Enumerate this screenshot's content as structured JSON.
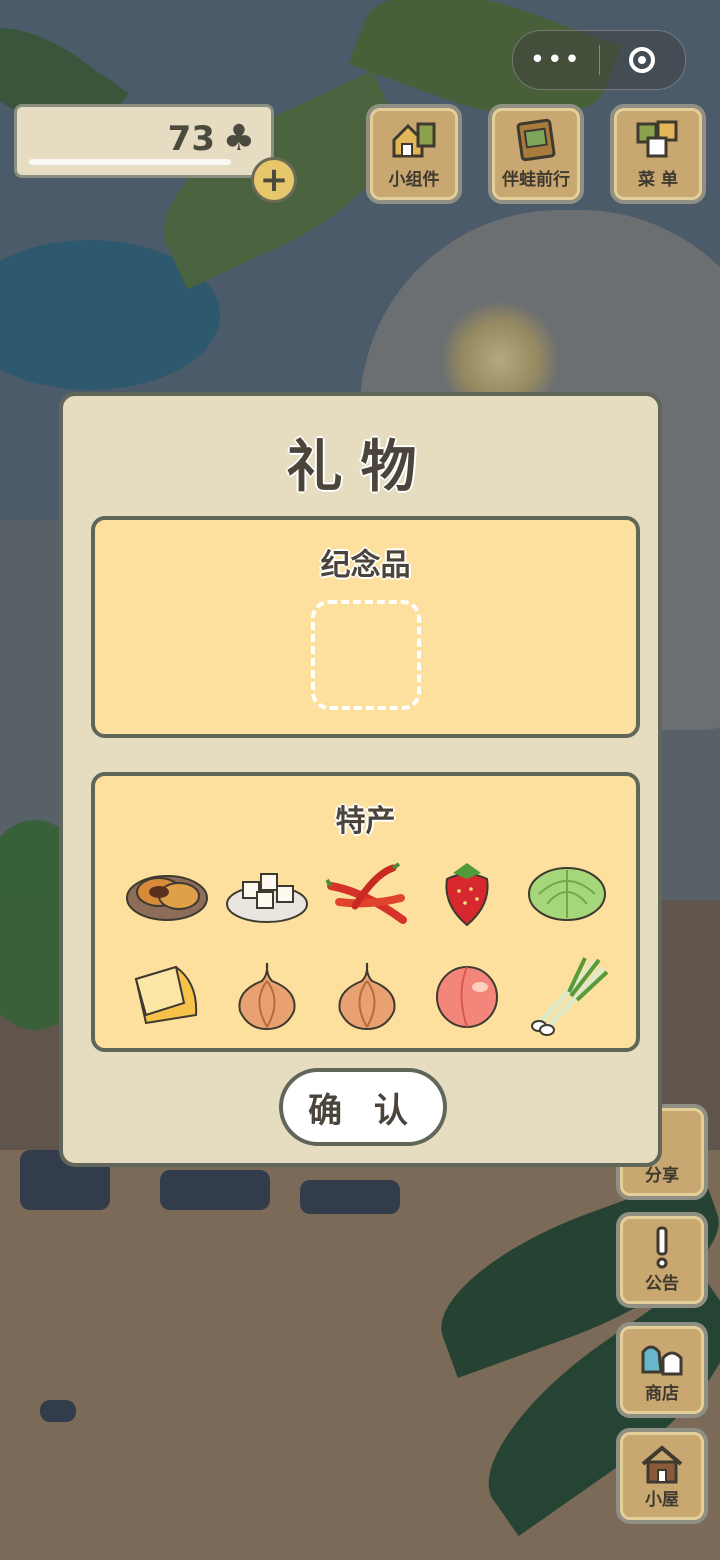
{
  "top_bar": {
    "capsule_more_icon": "more-dots-icon",
    "capsule_close_icon": "target-icon"
  },
  "counter": {
    "value": "73",
    "icon": "clover-icon",
    "add_icon": "plus-icon"
  },
  "top_buttons": [
    {
      "label": "小组件",
      "icon": "widget-icon"
    },
    {
      "label": "伴蛙前行",
      "icon": "journey-card-icon"
    },
    {
      "label": "菜 单",
      "icon": "menu-cards-icon"
    }
  ],
  "side_buttons": [
    {
      "label": "分享",
      "icon": "share-icon"
    },
    {
      "label": "公告",
      "icon": "notice-icon"
    },
    {
      "label": "商店",
      "icon": "shop-icon"
    },
    {
      "label": "小屋",
      "icon": "house-icon"
    }
  ],
  "dialog": {
    "title": "礼物",
    "souvenir": {
      "title": "纪念品",
      "slot": "empty-slot"
    },
    "specialty": {
      "title": "特产",
      "items": [
        "pancake-icon",
        "tofu-icon",
        "chili-icon",
        "strawberry-icon",
        "cabbage-icon",
        "cheese-icon",
        "onion-icon",
        "onion-icon",
        "peach-icon",
        "scallion-icon"
      ]
    },
    "confirm_label": "确 认"
  },
  "colors": {
    "dialog_bg": "#e6dcc0",
    "panel_bg": "#fde09d",
    "border": "#60675a",
    "wood": "#c9a770"
  }
}
